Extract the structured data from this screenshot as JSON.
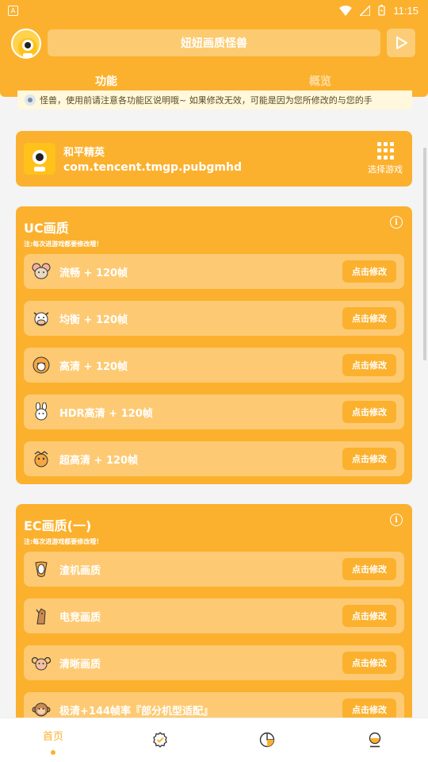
{
  "status_bar": {
    "left_icon": "A",
    "time": "11:15"
  },
  "app": {
    "title": "妞妞画质怪兽",
    "tabs": [
      "功能",
      "概览"
    ],
    "notice": "怪兽，使用前请注意各功能区说明哦~      如果修改无效，可能是因为您所修改的与您的手"
  },
  "game_card": {
    "name": "和平精英",
    "package": "com.tencent.tmgp.pubgmhd",
    "select_label": "选择游戏"
  },
  "panels": [
    {
      "title": "UC画质",
      "note": "注:每次进游戏都要修改哦！",
      "rows": [
        {
          "icon": "mouse-icon",
          "label": "流畅 + 120帧",
          "button": "点击修改"
        },
        {
          "icon": "cow-icon",
          "label": "均衡 + 120帧",
          "button": "点击修改"
        },
        {
          "icon": "tiger-icon",
          "label": "高清 + 120帧",
          "button": "点击修改"
        },
        {
          "icon": "rabbit-icon",
          "label": "HDR高清 + 120帧",
          "button": "点击修改"
        },
        {
          "icon": "dragon-icon",
          "label": "超高清 + 120帧",
          "button": "点击修改"
        }
      ]
    },
    {
      "title": "EC画质(一)",
      "note": "注:每次进游戏都要修改哦！",
      "rows": [
        {
          "icon": "snake-icon",
          "label": "渣机画质",
          "button": "点击修改"
        },
        {
          "icon": "horse-icon",
          "label": "电竞画质",
          "button": "点击修改"
        },
        {
          "icon": "goat-icon",
          "label": "清晰画质",
          "button": "点击修改"
        },
        {
          "icon": "monkey-icon",
          "label": "极清+144帧率『部分机型适配』",
          "button": "点击修改"
        }
      ]
    }
  ],
  "bottom_nav": {
    "home_label": "首页"
  },
  "colors": {
    "accent": "#fbb12e",
    "row_bg": "#fdca73",
    "background": "#f4f4f4"
  }
}
